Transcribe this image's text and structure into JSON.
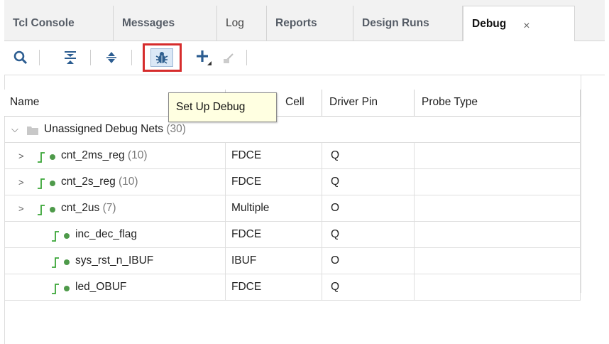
{
  "tabs": [
    {
      "label": "Tcl Console"
    },
    {
      "label": "Messages"
    },
    {
      "label": "Log"
    },
    {
      "label": "Reports"
    },
    {
      "label": "Design Runs"
    },
    {
      "label": "Debug"
    }
  ],
  "tab_close": "×",
  "tooltip": "Set Up Debug",
  "columns": {
    "name": "Name",
    "cell": "Cell",
    "driver_pin": "Driver Pin",
    "probe_type": "Probe Type"
  },
  "group": {
    "label": "Unassigned Debug Nets",
    "count": "(30)"
  },
  "rows": [
    {
      "name": "cnt_2ms_reg",
      "count": "(10)",
      "cell": "FDCE",
      "pin": "Q"
    },
    {
      "name": "cnt_2s_reg",
      "count": "(10)",
      "cell": "FDCE",
      "pin": "Q"
    },
    {
      "name": "cnt_2us",
      "count": "(7)",
      "cell": "Multiple",
      "pin": "O"
    },
    {
      "name": "inc_dec_flag",
      "count": "",
      "cell": "FDCE",
      "pin": "Q"
    },
    {
      "name": "sys_rst_n_IBUF",
      "count": "",
      "cell": "IBUF",
      "pin": "O"
    },
    {
      "name": "led_OBUF",
      "count": "",
      "cell": "FDCE",
      "pin": "Q"
    }
  ],
  "icons": {
    "search": "search-icon",
    "collapse": "collapse-all-icon",
    "expand": "expand-icon",
    "debug": "bug-icon",
    "add": "plus-icon",
    "action": "assign-icon"
  },
  "colors": {
    "highlight_border": "#d62c2c",
    "net_icon": "#3aa637",
    "toolbar_icon": "#2c5d91"
  }
}
